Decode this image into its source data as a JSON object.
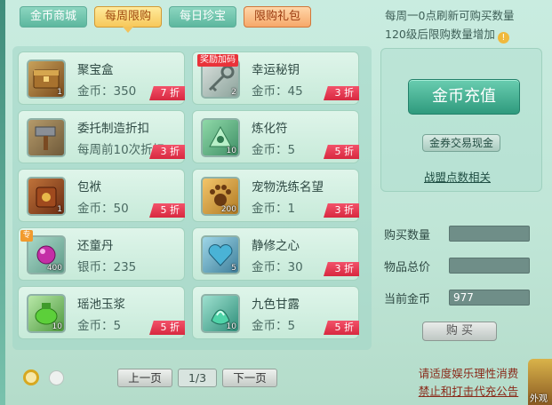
{
  "tabs": [
    {
      "label": "金币商城"
    },
    {
      "label": "每周限购"
    },
    {
      "label": "每日珍宝"
    },
    {
      "label": "限购礼包"
    }
  ],
  "info": {
    "line1": "每周一0点刷新可购买数量",
    "line2": "120级后限购数量增加",
    "icon": "info-icon"
  },
  "items": [
    {
      "name": "聚宝盒",
      "price": "金币：350",
      "count": "1",
      "discount": "7 折",
      "icon": "treasure-box-icon",
      "badge": ""
    },
    {
      "name": "幸运秘钥",
      "price": "金币：45",
      "count": "2",
      "discount": "3 折",
      "icon": "key-icon",
      "badge": "奖励加码"
    },
    {
      "name": "委托制造折扣",
      "price": "每周前10次折扣",
      "count": "",
      "discount": "3 折",
      "icon": "hammer-icon",
      "badge": ""
    },
    {
      "name": "炼化符",
      "price": "金币：5",
      "count": "10",
      "discount": "5 折",
      "icon": "talisman-icon",
      "badge": ""
    },
    {
      "name": "包袱",
      "price": "金币：50",
      "count": "1",
      "discount": "5 折",
      "icon": "bag-icon",
      "badge": ""
    },
    {
      "name": "宠物洗练名望",
      "price": "金币：1",
      "count": "200",
      "discount": "3 折",
      "icon": "paw-icon",
      "badge": ""
    },
    {
      "name": "还童丹",
      "price": "银币：235",
      "count": "400",
      "discount": "",
      "icon": "pill-icon",
      "badge": "专"
    },
    {
      "name": "静修之心",
      "price": "金币：30",
      "count": "5",
      "discount": "3 折",
      "icon": "heart-icon",
      "badge": ""
    },
    {
      "name": "瑶池玉浆",
      "price": "金币：5",
      "count": "10",
      "discount": "5 折",
      "icon": "jade-jar-icon",
      "badge": ""
    },
    {
      "name": "九色甘露",
      "price": "金币：5",
      "count": "10",
      "discount": "5 折",
      "icon": "dew-icon",
      "badge": ""
    }
  ],
  "pager": {
    "prev": "上一页",
    "page": "1/3",
    "next": "下一页"
  },
  "right": {
    "recharge": "金币充值",
    "exchange": "金券交易现金",
    "alliance": "战盟点数相关",
    "qty_label": "购买数量",
    "qty_value": "",
    "total_label": "物品总价",
    "total_value": "",
    "gold_label": "当前金币",
    "gold_value": "977",
    "buy": "购 买"
  },
  "notice": {
    "line1": "请适度娱乐理性消费",
    "line2": "禁止和打击代充公告"
  },
  "corner": {
    "label": "外观"
  }
}
